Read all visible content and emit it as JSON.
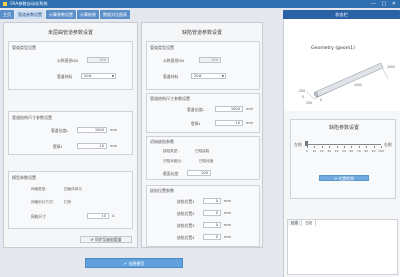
{
  "window": {
    "title": "FAA参数自动化系统"
  },
  "tabs": [
    {
      "label": "主页"
    },
    {
      "label": "管道参数设置"
    },
    {
      "label": "计算参数设置"
    },
    {
      "label": "计算结果"
    },
    {
      "label": "数据对比图表"
    }
  ],
  "status_tab": "状态栏",
  "left_panel": {
    "title": "未屈曲管道参数设置",
    "section1": {
      "label": "管道类型设置",
      "nominal_label": "公称直径DN",
      "nominal_value": "150",
      "type_label": "管道材料",
      "type_value": "20#"
    },
    "section2": {
      "label": "管道结构尺寸参数设置",
      "length_label": "管道长度L",
      "length_value": "1500",
      "length_unit": "mm",
      "wall_label": "壁厚t",
      "wall_value": "10",
      "wall_unit": "mm"
    },
    "section3": {
      "label": "模型参数设置",
      "row1_label": "网格类型:",
      "row1_value": "四面体单元",
      "row2_label": "网格划分方式:",
      "row2_value": "扫掠",
      "row3_label": "网格尺寸",
      "row3_value": "10",
      "row3_unit": "4"
    },
    "sync_button": "同步至缺陷管道"
  },
  "middle_panel": {
    "title": "缺陷管道参数设置",
    "section1": {
      "label": "管道类型设置",
      "nominal_label": "公称直径DN",
      "nominal_value": "150",
      "type_label": "管道材料",
      "type_value": "20#"
    },
    "section2": {
      "label": "管道结构尺寸参数设置",
      "length_label": "管道长度L",
      "length_value": "1000",
      "length_unit": "mm",
      "wall_label": "壁厚t",
      "wall_value": "10",
      "wall_unit": "mm"
    },
    "section3": {
      "label": "初始缺陷参数",
      "row1_label": "缺陷类型:",
      "row1_value": "凹陷缺陷",
      "row2_label": "凹陷深度比:",
      "row2_value": "凹陷深度",
      "row3_label": "截面长度",
      "row3_value": "100"
    },
    "section4": {
      "label": "缺陷位置参数",
      "p1_label": "缺陷位置1",
      "p1_value": "0",
      "p2_label": "缺陷位置2",
      "p2_value": "0",
      "p3_label": "缺陷位置3",
      "p3_value": "0",
      "p4_label": "缺陷位置4",
      "p4_value": "0",
      "unit": "mm"
    }
  },
  "create_button": "创建模型",
  "right_panel": {
    "geometry_title": "Geometry (geom1)",
    "axis_labels": [
      "2000",
      "1000",
      "0",
      "-200",
      "0",
      "200"
    ],
    "slider_title": "缺陷参数设置",
    "slider_left_label": "左侧",
    "slider_right_label": "右侧",
    "slider_ticks": [
      "0",
      "10",
      "20",
      "30",
      "40",
      "50",
      "60",
      "70",
      "80",
      "90",
      "100"
    ],
    "apply_button": "位置检测",
    "log_tabs": [
      "信息",
      "日志"
    ]
  }
}
